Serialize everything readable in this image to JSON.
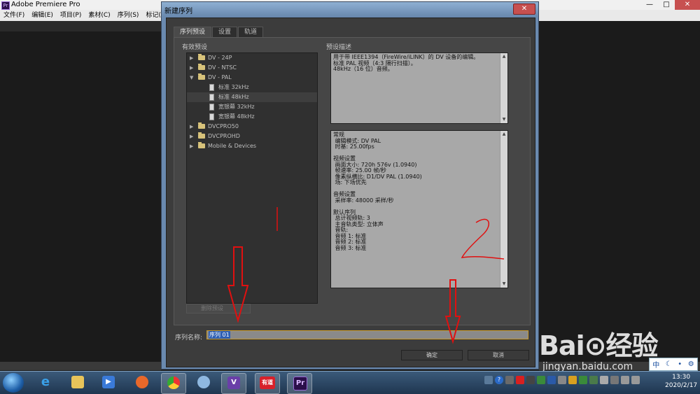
{
  "app": {
    "title": "Adobe Premiere Pro",
    "logo": "Pr"
  },
  "window_buttons": {
    "minimize": "—",
    "maximize": "□",
    "close": "✕"
  },
  "menu": [
    "文件(F)",
    "编辑(E)",
    "项目(P)",
    "素材(C)",
    "序列(S)",
    "标记(M)"
  ],
  "dialog": {
    "title": "新建序列",
    "close": "✕",
    "tabs": [
      "序列预设",
      "设置",
      "轨道"
    ],
    "presets_group": "有效预设",
    "tree": [
      {
        "label": "DV - 24P",
        "type": "folder",
        "expanded": false
      },
      {
        "label": "DV - NTSC",
        "type": "folder",
        "expanded": false
      },
      {
        "label": "DV - PAL",
        "type": "folder",
        "expanded": true
      },
      {
        "label": "标准 32kHz",
        "type": "file"
      },
      {
        "label": "标准 48kHz",
        "type": "file",
        "selected": true
      },
      {
        "label": "宽银幕 32kHz",
        "type": "file"
      },
      {
        "label": "宽银幕 48kHz",
        "type": "file"
      },
      {
        "label": "DVCPRO50",
        "type": "folder",
        "expanded": false
      },
      {
        "label": "DVCPROHD",
        "type": "folder",
        "expanded": false
      },
      {
        "label": "Mobile & Devices",
        "type": "folder",
        "expanded": false
      }
    ],
    "delete_preset": "删除预设",
    "desc_group": "预设描述",
    "description": "用于带 IEEE1394（FireWire/iLINK）的 DV 设备的编辑。\n标准 PAL 视频（4:3 隔行扫描）。\n48kHz（16 位）音频。",
    "details": "常规\n 编辑模式: DV PAL\n 时基: 25.00fps\n\n视频设置\n 画面大小: 720h 576v (1.0940)\n 帧速率: 25.00 帧/秒\n 像素纵横比: D1/DV PAL (1.0940)\n 场: 下场优先\n\n音频设置\n 采样率: 48000 采样/秒\n\n默认序列\n 总计视频轨: 3\n 主音轨类型: 立体声\n 音轨:\n 音频 1: 标准\n 音频 2: 标准\n 音频 3: 标准",
    "sequence_name_label": "序列名称:",
    "sequence_name": "序列 01",
    "ok": "确定",
    "cancel": "取消"
  },
  "annotations": {
    "one": "|",
    "two": "2",
    "color": "#e01010"
  },
  "watermark": {
    "logo": "Bai⊙经验",
    "url": "jingyan.baidu.com"
  },
  "ime": {
    "lang": "中",
    "moon": "☾",
    "dot": "•",
    "gear": "⚙"
  },
  "taskbar": {
    "apps": [
      "windows-explorer",
      "internet-explorer",
      "file-manager",
      "media-player",
      "firefox",
      "chrome",
      "paint",
      "visual-studio",
      "youdao",
      "premiere"
    ],
    "youdao_label": "有道",
    "premiere_label": "Pr",
    "vs_label": "V",
    "time": "13:30",
    "date": "2020/2/17"
  }
}
